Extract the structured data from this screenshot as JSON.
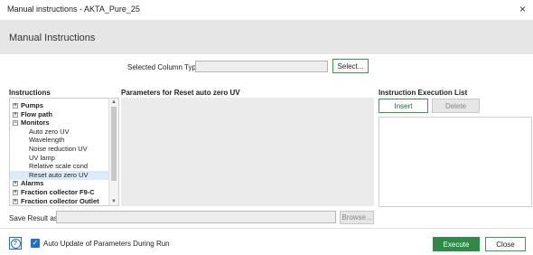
{
  "window": {
    "title": "Manual instructions - AKTA_Pure_25",
    "close_glyph": "×"
  },
  "header": {
    "title": "Manual Instructions"
  },
  "column_type": {
    "label": "Selected Column Type",
    "value": "",
    "button": "Select..."
  },
  "instructions": {
    "heading": "Instructions",
    "tree": [
      {
        "label": "Pumps",
        "type": "category",
        "expander": "+"
      },
      {
        "label": "Flow path",
        "type": "category",
        "expander": "+"
      },
      {
        "label": "Monitors",
        "type": "category",
        "expander": "−"
      },
      {
        "label": "Auto zero UV",
        "type": "child"
      },
      {
        "label": "Wavelength",
        "type": "child"
      },
      {
        "label": "Noise reduction UV",
        "type": "child"
      },
      {
        "label": "UV lamp",
        "type": "child"
      },
      {
        "label": "Relative scale cond",
        "type": "child"
      },
      {
        "label": "Reset auto zero UV",
        "type": "child",
        "selected": true
      },
      {
        "label": "Alarms",
        "type": "category",
        "expander": "+"
      },
      {
        "label": "Fraction collector F9-C",
        "type": "category",
        "expander": "+"
      },
      {
        "label": "Fraction collector Outlet",
        "type": "category",
        "expander": "+"
      }
    ]
  },
  "parameters": {
    "heading": "Parameters for Reset auto zero UV"
  },
  "execution_list": {
    "heading": "Instruction Execution List",
    "insert": "Insert",
    "delete": "Delete"
  },
  "save_result": {
    "label": "Save Result as",
    "value": "",
    "button": "Browse..."
  },
  "footer": {
    "help_icon": "question-circle-icon",
    "auto_update_label": "Auto Update of Parameters During Run",
    "auto_update_checked": true,
    "execute": "Execute",
    "close": "Close"
  },
  "colors": {
    "accent": "#2e8b47",
    "selection": "#d9ecf8",
    "header_bg": "#e6e6e6",
    "checkbox": "#1f6fd1"
  }
}
